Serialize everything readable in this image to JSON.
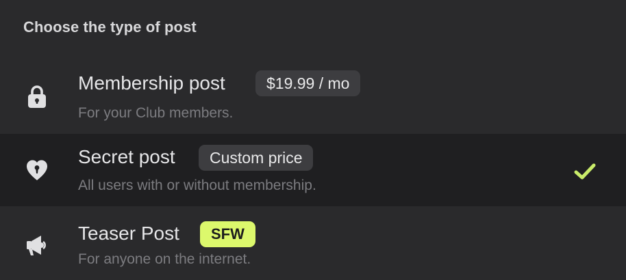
{
  "title": "Choose the type of post",
  "options": [
    {
      "name": "Membership post",
      "badge": "$19.99 / mo",
      "description": "For your Club members.",
      "icon": "lock-icon",
      "selected": false
    },
    {
      "name": "Secret post",
      "badge": "Custom price",
      "description": "All users with or without membership.",
      "icon": "keyhole-heart-icon",
      "selected": true
    },
    {
      "name": "Teaser Post",
      "badge": "SFW",
      "description": "For anyone on the internet.",
      "icon": "megaphone-icon",
      "selected": false
    }
  ],
  "colors": {
    "background": "#2a2a2c",
    "selected_row": "#1f1f21",
    "accent_lime": "#dcf86c",
    "badge_dark": "#3d3d40",
    "check": "#c9ec6a"
  }
}
